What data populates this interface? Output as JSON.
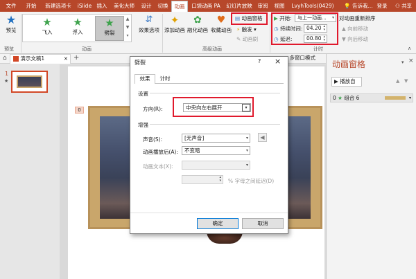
{
  "app": {
    "tabs": [
      "文件",
      "开始",
      "新建选项卡",
      "iSlide",
      "插入",
      "美化大师",
      "设计",
      "切换",
      "动画",
      "幻灯片放映",
      "审阅",
      "视图",
      "LvyhTools(0429)"
    ],
    "tab_extra": "口袋动画 PA",
    "active_tab": "动画",
    "help_search": "告诉我...",
    "login": "登录",
    "share": "共享"
  },
  "ribbon": {
    "preview_label": "预览",
    "preview_group": "预览",
    "animation_group": "动画",
    "advanced_group": "高级动画",
    "timing_group": "计时",
    "effects": [
      "飞入",
      "浮入",
      "劈裂"
    ],
    "selected_effect": "劈裂",
    "effect_options": "效果选项",
    "add_animation": "添加动画",
    "animation_painter": "动画刷",
    "trigger": "触发",
    "animation_pane_btn": "动画窗格",
    "start_label": "开始:",
    "start_value": "与上一动画...",
    "duration_label": "持续时间:",
    "duration_value": "04.20",
    "delay_label": "延迟:",
    "delay_value": "00.80",
    "reorder_title": "对动画重新排序",
    "move_earlier": "向前移动",
    "move_later": "向后移动",
    "fade_label": "融化动画",
    "shrink_label": "收藏动画"
  },
  "doc": {
    "tab_name": "演示文稿1",
    "multi_window": "多窗口模式",
    "slide_number": "1",
    "anim_tag": "0"
  },
  "pane": {
    "title": "动画窗格",
    "play_btn": "播放自",
    "item_index": "0",
    "item_name": "组合 6"
  },
  "dialog": {
    "title": "劈裂",
    "help": "?",
    "close": "×",
    "tab_effect": "效果",
    "tab_timing": "计时",
    "settings_header": "设置",
    "direction_label": "方向(R):",
    "direction_value": "中央向左右展开",
    "enhance_header": "增强",
    "sound_label": "声音(S):",
    "sound_value": "[无声音]",
    "after_label": "动画播放后(A):",
    "after_value": "不变暗",
    "text_anim_label": "动画文本(X):",
    "delay_suffix": "% 字母之间延迟(D)",
    "ok": "确定",
    "cancel": "取消"
  },
  "colors": {
    "brand": "#b7472a",
    "highlight": "#e0192c",
    "accent_blue": "#0078d7"
  }
}
